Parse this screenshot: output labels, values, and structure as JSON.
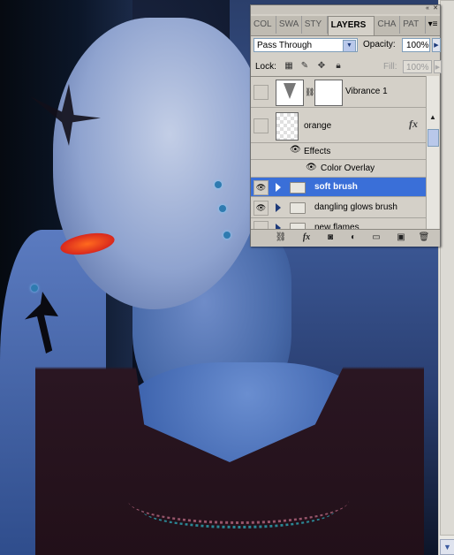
{
  "panel": {
    "tabs": [
      {
        "label": "COL",
        "active": false
      },
      {
        "label": "SWA",
        "active": false
      },
      {
        "label": "STY",
        "active": false
      },
      {
        "label": "LAYERS",
        "active": true
      },
      {
        "label": "CHA",
        "active": false
      },
      {
        "label": "PAT",
        "active": false
      }
    ],
    "blend_mode": "Pass Through",
    "opacity_label": "Opacity:",
    "opacity_value": "100%",
    "lock_label": "Lock:",
    "fill_label": "Fill:",
    "fill_value": "100%",
    "layers": [
      {
        "name": "Vibrance 1",
        "type": "adjustment",
        "visible": false
      },
      {
        "name": "orange",
        "type": "layer",
        "visible": false,
        "fx": "fx"
      },
      {
        "name": "Effects",
        "type": "effects-header"
      },
      {
        "name": "Color Overlay",
        "type": "effect"
      },
      {
        "name": "soft brush",
        "type": "group",
        "visible": true,
        "selected": true
      },
      {
        "name": "dangling glows brush",
        "type": "group",
        "visible": true
      },
      {
        "name": "new flames",
        "type": "group",
        "visible": false
      }
    ],
    "bottom_icons": [
      "link-icon",
      "fx-icon",
      "mask-icon",
      "adjustment-icon",
      "folder-icon",
      "new-layer-icon",
      "trash-icon"
    ]
  },
  "colors": {
    "panel_bg": "#d4d0c8",
    "selection": "#3a6fd8",
    "scroll_arrow": "#3c5ba0"
  }
}
